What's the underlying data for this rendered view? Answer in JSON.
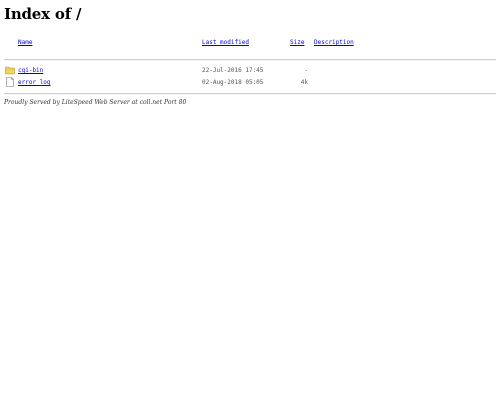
{
  "page": {
    "title": "Index of /"
  },
  "columns": {
    "name": "Name",
    "last_modified": "Last modified",
    "size": "Size",
    "description": "Description"
  },
  "entries": [
    {
      "icon": "folder-icon",
      "name": "cgi-bin",
      "modified": "22-Jul-2016 17:45",
      "size": "-",
      "description": ""
    },
    {
      "icon": "file-icon",
      "name": "error_log",
      "modified": "02-Aug-2018 05:05",
      "size": "4k",
      "description": ""
    }
  ],
  "footer": {
    "text": "Proudly Served by LiteSpeed Web Server at coll.net Port 80"
  },
  "colors": {
    "link": "#0000ee",
    "folder": "#f2d35c",
    "rule": "#d0d0d0"
  }
}
